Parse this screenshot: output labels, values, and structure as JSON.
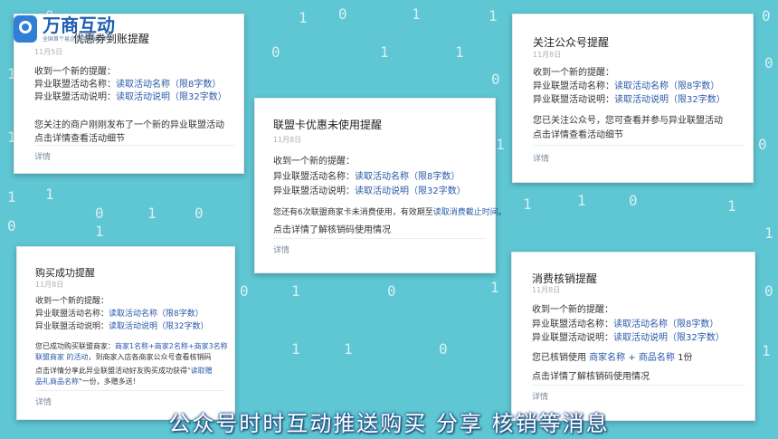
{
  "logo": {
    "brand": "万商互动",
    "tagline": "全国首个易企业营销服务平台"
  },
  "bg_digits": [
    "0",
    "1",
    "0",
    "1",
    "1",
    "0",
    "0",
    "1",
    "1",
    "0",
    "1",
    "0",
    "1",
    "1",
    "0",
    "1",
    "1",
    "0",
    "1",
    "0",
    "1",
    "1",
    "0",
    "1",
    "0",
    "1",
    "1",
    "0",
    "1",
    "0",
    "1",
    "0",
    "1",
    "1",
    "0",
    "1"
  ],
  "cards": {
    "c1": {
      "title": "优惠券到账提醒",
      "date": "11月5日",
      "greeting": "收到一个新的提醒：",
      "name_label": "异业联盟活动名称：",
      "name_link": "读取活动名称",
      "name_limit": "（限8字数）",
      "desc_label": "异业联盟活动说明：",
      "desc_link": "读取活动说明",
      "desc_limit": "（限32字数）",
      "body1": "您关注的商户刚刚发布了一个新的异业联盟活动",
      "body2": "点击详情查看活动细节",
      "details": "详情"
    },
    "c2": {
      "title": "联盟卡优惠未使用提醒",
      "date": "11月8日",
      "greeting": "收到一个新的提醒：",
      "name_label": "异业联盟活动名称：",
      "name_link": "读取活动名称",
      "name_limit": "（限8字数）",
      "desc_label": "异业联盟活动说明：",
      "desc_link": "读取活动说明",
      "desc_limit": "（限32字数）",
      "body1": "您还有6次联盟商家卡未消费使用，有效期至",
      "body1_link": "读取消费截止时间",
      "body1_end": "。",
      "body2": "点击详情了解核销码使用情况",
      "details": "详情"
    },
    "c3": {
      "title": "关注公众号提醒",
      "date": "11月8日",
      "greeting": "收到一个新的提醒：",
      "name_label": "异业联盟活动名称：",
      "name_link": "读取活动名称",
      "name_limit": "（限8字数）",
      "desc_label": "异业联盟活动说明：",
      "desc_link": "读取活动说明",
      "desc_limit": "（限32字数）",
      "body1": "您已关注公众号，您可查看并参与异业联盟活动",
      "body2": "点击详情查看活动细节",
      "details": "详情"
    },
    "c4": {
      "title": "购买成功提醒",
      "date": "11月8日",
      "greeting": "收到一个新的提醒：",
      "name_label": "异业联盟活动名称：",
      "name_link": "读取活动名称",
      "name_limit": "（限8字数）",
      "desc_label": "异业联盟活动说明：",
      "desc_link": "读取活动说明",
      "desc_limit": "（限32字数）",
      "body1": "您已成功购买联盟商家：",
      "body1_link": "商家1名称+商家2名称+商家3名称",
      "body2_link": "联盟商家 的活动",
      "body2": "，到商家入店各商家公众号查看核销码",
      "body3": "点击详情分享此异业联盟活动好友购买成功获得",
      "body3_link": "\"读取赠",
      "body4_link": "品礼商品名称",
      "body4": "\"一份，多赠多送！",
      "details": "详情"
    },
    "c5": {
      "title": "消费核销提醒",
      "date": "11月8日",
      "greeting": "收到一个新的提醒：",
      "name_label": "异业联盟活动名称：",
      "name_link": "读取活动名称",
      "name_limit": "（限8字数）",
      "desc_label": "异业联盟活动说明：",
      "desc_link": "读取活动说明",
      "desc_limit": "（限32字数）",
      "body1": "您已核销使用",
      "body1_link": "商家名称 + 商品名称",
      "body1_end": "1份",
      "body2": "点击详情了解核销码使用情况",
      "details": "详情"
    }
  },
  "subtitle": "公众号时时互动推送购买 分享 核销等消息"
}
